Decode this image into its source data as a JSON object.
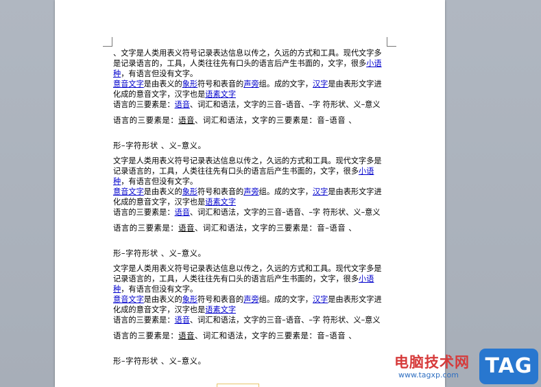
{
  "document": {
    "block1": {
      "p1_a": "、文字是人类用表义符号记录表达信息以传之，久远的方式和工具。现代文字多是记录语言的，工具，人类往往先有口头的语言后产生书面的，文字，很多",
      "p1_link": "小语种",
      "p1_b": "，有语言但没有文字。",
      "p2_link1": "意音文字",
      "p2_a": "是由表义的",
      "p2_link2": "象形",
      "p2_b": "符号和表音的",
      "p2_link3": "声旁",
      "p2_c": "组。成的文字，",
      "p2_link4": "汉字",
      "p2_d": "是由表形文字进化成的意音文字，汉字也是",
      "p2_link5": "语素文字",
      "p3_a": "语言的三要素是：",
      "p3_link": "语音",
      "p3_b": "、词汇和语法，文字的三音–语音、–字 符形状、义–意义",
      "p4_a": "语言的三要素是：",
      "p4_u": "语音",
      "p4_b": "、词汇和语法，文字的三要素是：音–语音 、",
      "p5": "形–字符形状 、义–意义。"
    },
    "block2": {
      "p1_a": "文字是人类用表义符号记录表达信息以传之，久远的方式和工具。现代文字多是记录语言的，工具，人类往往先有口头的语言后产生书面的，文字，很多",
      "p1_link": "小语种",
      "p1_b": "，有语言但没有文字。",
      "p2_link1": "意音文字",
      "p2_a": "是由表义的",
      "p2_link2": "象形",
      "p2_b": "符号和表音的",
      "p2_link3": "声旁",
      "p2_c": "组。成的文字，",
      "p2_link4": "汉字",
      "p2_d": "是由表形文字进化成的意音文字，汉字也是",
      "p2_link5": "语素文字",
      "p3_a": "语言的三要素是：",
      "p3_link": "语音",
      "p3_b": "、词汇和语法，文字的三音–语音、–字 符形状、义–意义",
      "p4_a": "语言的三要素是：",
      "p4_u": "语音",
      "p4_b": "、词汇和语法，文字的三要素是：音–语音 、",
      "p5": "形–字符形状 、义–意义。"
    },
    "block3": {
      "p1_a": "文字是人类用表义符号记录表达信息以传之，久远的方式和工具。现代文字多是记录语言的，工具，人类往往先有口头的语言后产生书面的，文字，很多",
      "p1_link": "小语种",
      "p1_b": "，有语言但没有文字。",
      "p2_link1": "意音文字",
      "p2_a": "是由表义的",
      "p2_link2": "象形",
      "p2_b": "符号和表音的",
      "p2_link3": "声旁",
      "p2_c": "组。成的文字，",
      "p2_link4": "汉字",
      "p2_d": "是由表形文字进化成的意音文字，汉字也是",
      "p2_link5": "语素文字",
      "p3_a": "语言的三要素是：",
      "p3_link": "语音",
      "p3_b": "、词汇和语法，文字的三音–语音、–字 符形状、义–意义",
      "p4_a": "语言的三要素是：",
      "p4_u": "语音",
      "p4_b": "、词汇和语法，文字的三要素是：音–语音 、",
      "p5": "形–字符形状 、义–意义。"
    }
  },
  "watermark": {
    "site_name": "电脑技术网",
    "url": "www.tagxp.com",
    "tag": "TAG"
  },
  "colors": {
    "link": "#0000cc",
    "background": "#a7aeb8",
    "watermark_red": "#d63a3a",
    "watermark_blue": "#2877cf"
  }
}
